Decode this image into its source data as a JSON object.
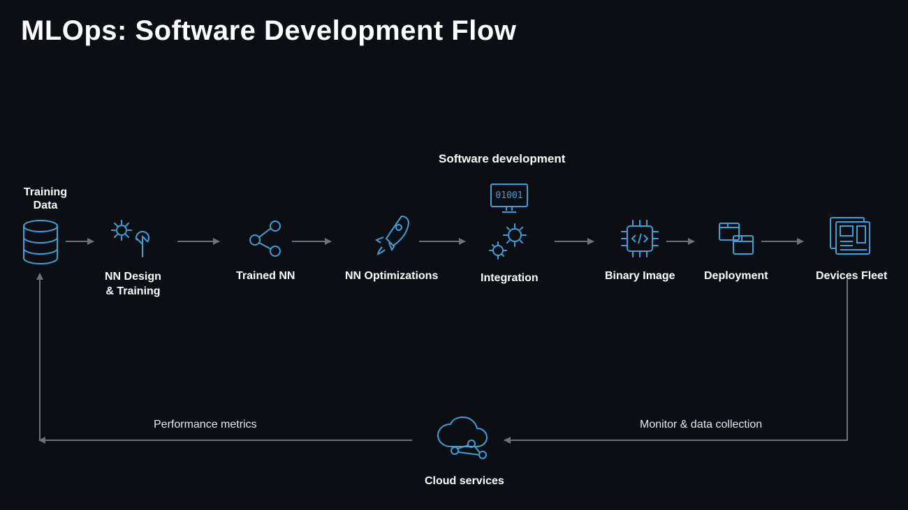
{
  "title": "MLOps: Software Development Flow",
  "section_label": "Software development",
  "nodes": {
    "training_data": "Training Data",
    "nn_design": "NN Design\n& Training",
    "trained_nn": "Trained NN",
    "nn_opt": "NN Optimizations",
    "integration": "Integration",
    "binary_image": "Binary Image",
    "deployment": "Deployment",
    "devices_fleet": "Devices Fleet",
    "cloud_services": "Cloud services"
  },
  "feedback": {
    "left": "Performance metrics",
    "right": "Monitor & data collection"
  },
  "colors": {
    "accent": "#3ea0d6",
    "bg": "#0b0f14",
    "arrow": "#6c7279"
  }
}
